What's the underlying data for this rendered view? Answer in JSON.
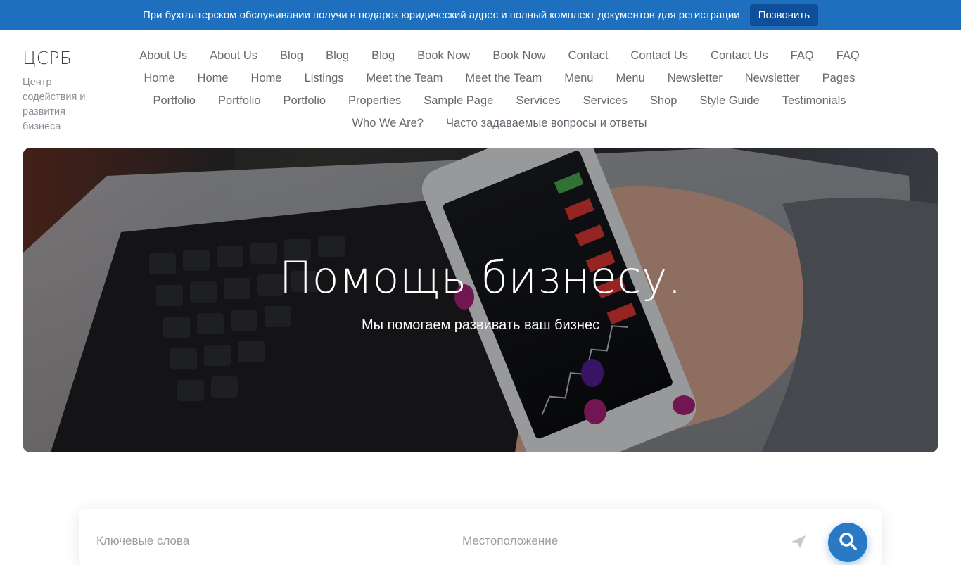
{
  "topbar": {
    "message": "При бухгалтерском обслуживании получи в подарок юридический адрес и полный комплект документов для регистрации",
    "button_label": "Позвонить"
  },
  "logo": {
    "title": "ЦСРБ",
    "tagline": "Центр содействия и развития бизнеса"
  },
  "nav": {
    "items": [
      "About Us",
      "About Us",
      "Blog",
      "Blog",
      "Blog",
      "Book Now",
      "Book Now",
      "Contact",
      "Contact Us",
      "Contact Us",
      "FAQ",
      "FAQ",
      "Home",
      "Home",
      "Home",
      "Listings",
      "Meet the Team",
      "Meet the Team",
      "Menu",
      "Menu",
      "Newsletter",
      "Newsletter",
      "Pages",
      "Portfolio",
      "Portfolio",
      "Portfolio",
      "Properties",
      "Sample Page",
      "Services",
      "Services",
      "Shop",
      "Style Guide",
      "Testimonials",
      "Who We Are?",
      "Часто задаваемые вопросы и ответы"
    ]
  },
  "hero": {
    "title": "Помощь бизнесу.",
    "subtitle": "Мы помогаем развивать ваш бизнес"
  },
  "search": {
    "keywords_label": "Ключевые слова",
    "location_label": "Местоположение"
  },
  "colors": {
    "topbar_bg": "#1e6fbe",
    "topbar_button_bg": "#0f4f99",
    "search_button_bg": "#2a79c4"
  }
}
